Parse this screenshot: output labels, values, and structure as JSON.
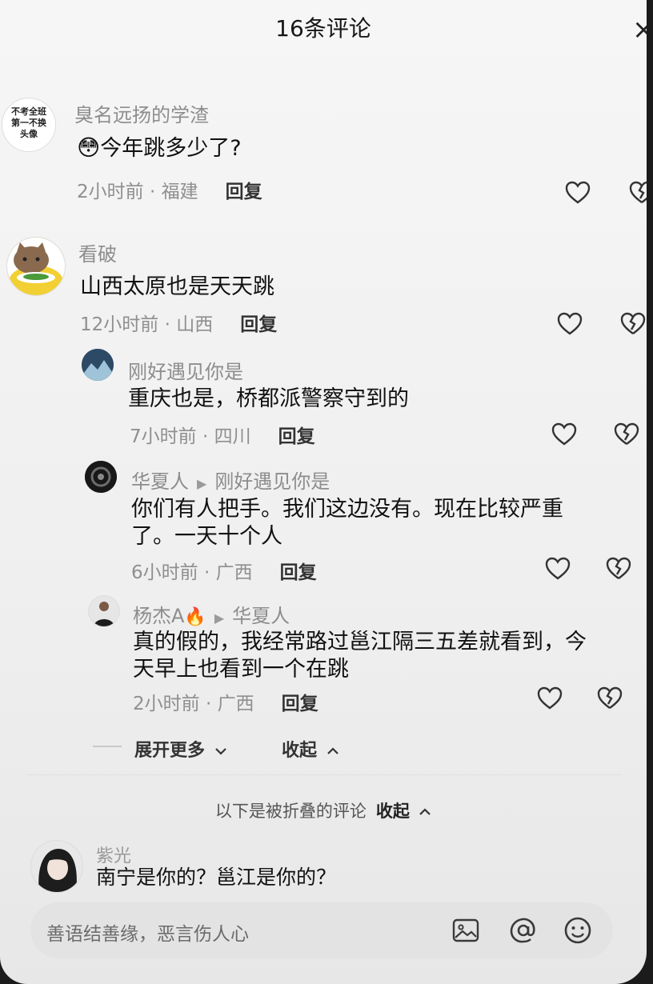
{
  "header": {
    "title": "16条评论",
    "close_label": "×"
  },
  "comments": [
    {
      "user": "臭名远扬的学渣",
      "avatar_text": "不考全班\n第一不换\n头像",
      "emoji": "😳",
      "text": "今年跳多少了?",
      "time_location": "2小时前 · 福建",
      "reply_label": "回复"
    },
    {
      "user": "看破",
      "text": "山西太原也是天天跳",
      "time_location": "12小时前 · 山西",
      "reply_label": "回复"
    },
    {
      "user": "刚好遇见你是",
      "text": "重庆也是，桥都派警察守到的",
      "time_location": "7小时前 · 四川",
      "reply_label": "回复"
    },
    {
      "user": "华夏人",
      "reply_to": "刚好遇见你是",
      "text_line1": "你们有人把手。我们这边没有。现在比较严重",
      "text_line2": "了。一天十个人",
      "time_location": "6小时前 · 广西",
      "reply_label": "回复"
    },
    {
      "user": "杨杰A",
      "user_emoji": "🔥",
      "reply_to": "华夏人",
      "text_line1": "真的假的，我经常路过邕江隔三五差就看到，今",
      "text_line2": "天早上也看到一个在跳",
      "time_location": "2小时前 · 广西",
      "reply_label": "回复"
    }
  ],
  "fold": {
    "expand_more": "展开更多",
    "collapse": "收起",
    "chevron_down": "⌄",
    "chevron_up": "⌃"
  },
  "folded_section": {
    "note": "以下是被折叠的评论",
    "collapse": "收起"
  },
  "folded_comment": {
    "user": "紫光",
    "text": "南宁是你的？邕江是你的？"
  },
  "input": {
    "placeholder": "善语结善缘，恶言伤人心"
  },
  "icons": {
    "like": "heart-outline-icon",
    "dislike": "broken-heart-icon",
    "image": "image-icon",
    "mention": "at-icon",
    "emoji": "smiley-icon"
  }
}
